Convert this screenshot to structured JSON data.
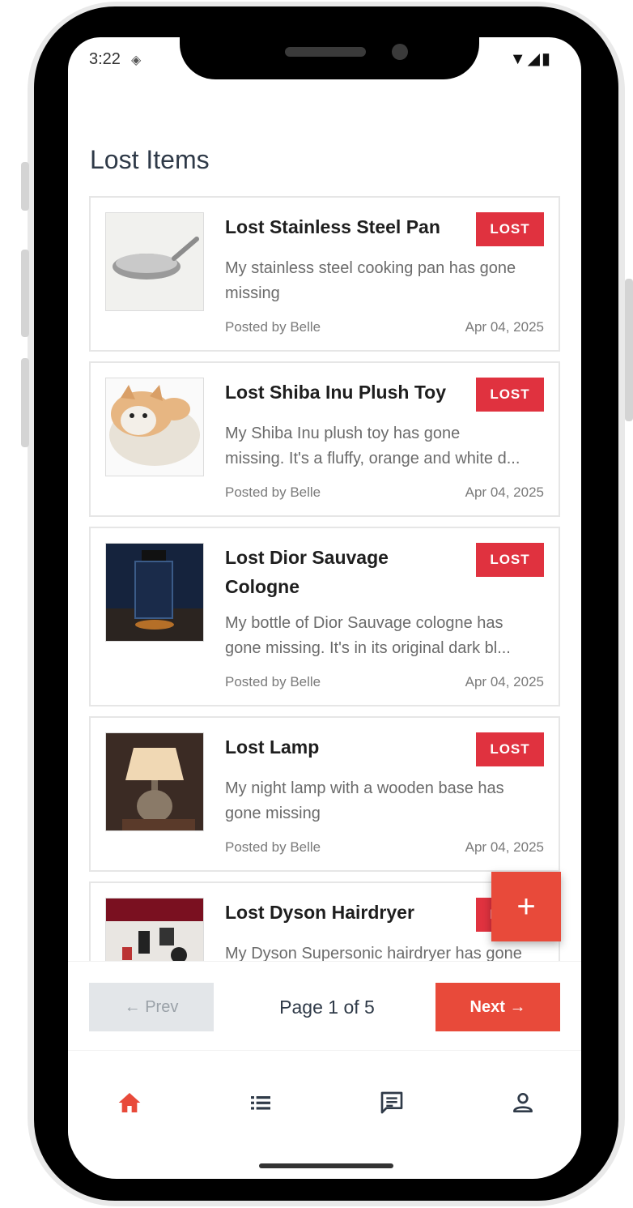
{
  "status_bar": {
    "time": "3:22"
  },
  "header": {
    "title": "Lost Items"
  },
  "items": [
    {
      "title": "Lost Stainless Steel Pan",
      "badge": "LOST",
      "description_line1": "My stainless steel cooking pan has gone",
      "description_line2": "missing",
      "author": "Posted by Belle",
      "date": "Apr 04, 2025"
    },
    {
      "title": "Lost Shiba Inu Plush Toy",
      "badge": "LOST",
      "description_line1": "My Shiba Inu plush toy has gone",
      "description_line2": "missing. It's a fluffy, orange and white d...",
      "author": "Posted by Belle",
      "date": "Apr 04, 2025"
    },
    {
      "title_line1": "Lost Dior Sauvage",
      "title_line2": "Cologne",
      "badge": "LOST",
      "description_line1": "My bottle of Dior Sauvage cologne has",
      "description_line2": "gone missing. It's in its original dark bl...",
      "author": "Posted by Belle",
      "date": "Apr 04, 2025"
    },
    {
      "title": "Lost Lamp",
      "badge": "LOST",
      "description_line1": "My night lamp with a wooden base has",
      "description_line2": "gone missing",
      "author": "Posted by Belle",
      "date": "Apr 04, 2025"
    },
    {
      "title": "Lost Dyson Hairdryer",
      "badge": "LOST",
      "description_line1": "My Dyson Supersonic hairdryer has gone"
    }
  ],
  "fab": {
    "label": "+"
  },
  "pagination": {
    "prev_label": "← Prev",
    "page_label": "Page 1 of 5",
    "next_label": "Next →"
  },
  "bottom_nav": [
    {
      "icon": "home-icon",
      "active": true
    },
    {
      "icon": "list-icon",
      "active": false
    },
    {
      "icon": "chat-icon",
      "active": false
    },
    {
      "icon": "profile-icon",
      "active": false
    }
  ],
  "colors": {
    "accent": "#e84a3a",
    "badge": "#e0323f",
    "title": "#2f3a48",
    "muted": "#6b6b6b"
  }
}
